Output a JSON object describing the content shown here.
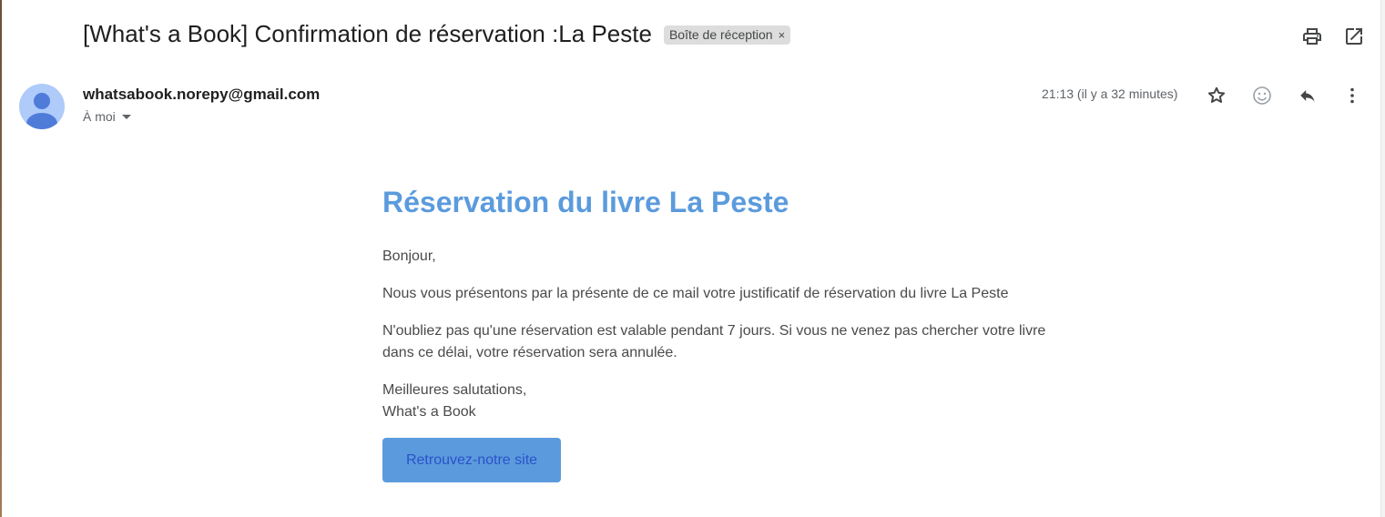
{
  "email": {
    "subject": "[What's a Book] Confirmation de réservation :La Peste",
    "label": "Boîte de réception",
    "label_remove": "×",
    "sender": "whatsabook.norepy@gmail.com",
    "recipient": "À moi",
    "timestamp": "21:13 (il y a 32 minutes)"
  },
  "icons": {
    "print": "print-icon",
    "open_new_window": "open-in-new-window-icon",
    "star": "star-icon",
    "emoji": "emoji-icon",
    "reply": "reply-icon",
    "more": "more-vert-icon"
  },
  "body": {
    "heading": "Réservation du livre La Peste",
    "greeting": "Bonjour,",
    "paragraph1": "Nous vous présentons par la présente de ce mail votre justificatif de réservation du livre La Peste",
    "paragraph2_line1": "N'oubliez pas qu'une réservation est valable pendant 7 jours. Si vous ne venez pas chercher votre livre",
    "paragraph2_line2": "dans ce délai, votre réservation sera annulée.",
    "closing_line1": "Meilleures salutations,",
    "closing_line2": "What's a Book",
    "button_label": "Retrouvez-notre site"
  },
  "colors": {
    "heading": "#5b9bdd",
    "button_bg": "#5b9bdd",
    "button_text": "#2a52c9",
    "avatar_bg": "#aecbfa",
    "avatar_figure": "#4f7cd9",
    "chip_bg": "#dddddd"
  }
}
